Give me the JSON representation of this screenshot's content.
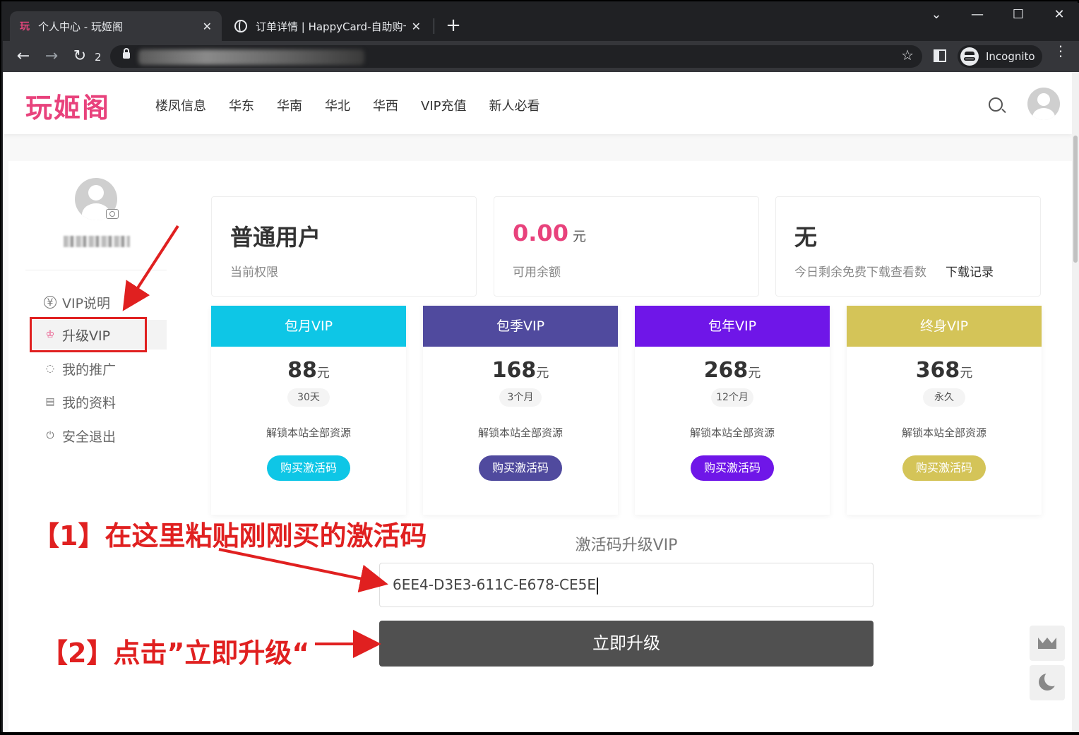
{
  "browser": {
    "tabs": [
      {
        "favicon_text": "玩",
        "title": "个人中心 - 玩姬阁",
        "close": "✕"
      },
      {
        "title": "订单详情 | HappyCard-自助购卡",
        "close": "✕"
      }
    ],
    "new_tab": "+",
    "window_controls": {
      "minimize": "—",
      "maximize": "☐",
      "close": "✕",
      "tab_search": "⌄"
    },
    "nav": {
      "back": "←",
      "forward": "→",
      "reload": "↻",
      "reload_count": "2"
    },
    "star": "☆",
    "incognito_label": "Incognito",
    "menu": "⋮"
  },
  "site": {
    "logo": "玩姬阁",
    "nav": [
      "楼凤信息",
      "华东",
      "华南",
      "华北",
      "华西",
      "VIP充值",
      "新人必看"
    ]
  },
  "sidebar": {
    "items": [
      {
        "icon": "¥",
        "label": "VIP说明"
      },
      {
        "icon": "♔",
        "label": "升级VIP"
      },
      {
        "icon": "◌",
        "label": "我的推广"
      },
      {
        "icon": "▤",
        "label": "我的资料"
      },
      {
        "icon": "⏻",
        "label": "安全退出"
      }
    ]
  },
  "stats": {
    "level": {
      "value": "普通用户",
      "label": "当前权限"
    },
    "balance": {
      "value": "0.00",
      "unit": "元",
      "label": "可用余额"
    },
    "downloads": {
      "value": "无",
      "label": "今日剩余免费下载查看数",
      "link": "下载记录"
    }
  },
  "plans": [
    {
      "name": "包月VIP",
      "price": "88",
      "unit": "元",
      "duration": "30天",
      "desc": "解锁本站全部资源",
      "button": "购买激活码",
      "color": "#0ec6e6"
    },
    {
      "name": "包季VIP",
      "price": "168",
      "unit": "元",
      "duration": "3个月",
      "desc": "解锁本站全部资源",
      "button": "购买激活码",
      "color": "#504a9e"
    },
    {
      "name": "包年VIP",
      "price": "268",
      "unit": "元",
      "duration": "12个月",
      "desc": "解锁本站全部资源",
      "button": "购买激活码",
      "color": "#6f16e8"
    },
    {
      "name": "终身VIP",
      "price": "368",
      "unit": "元",
      "duration": "永久",
      "desc": "解锁本站全部资源",
      "button": "购买激活码",
      "color": "#d4c458"
    }
  ],
  "activation": {
    "title": "激活码升级VIP",
    "code": "6EE4-D3E3-611C-E678-CE5E",
    "button": "立即升级"
  },
  "annotations": {
    "step1": "【1】在这里粘贴刚刚买的激活码",
    "step2": "【2】点击”立即升级“"
  }
}
